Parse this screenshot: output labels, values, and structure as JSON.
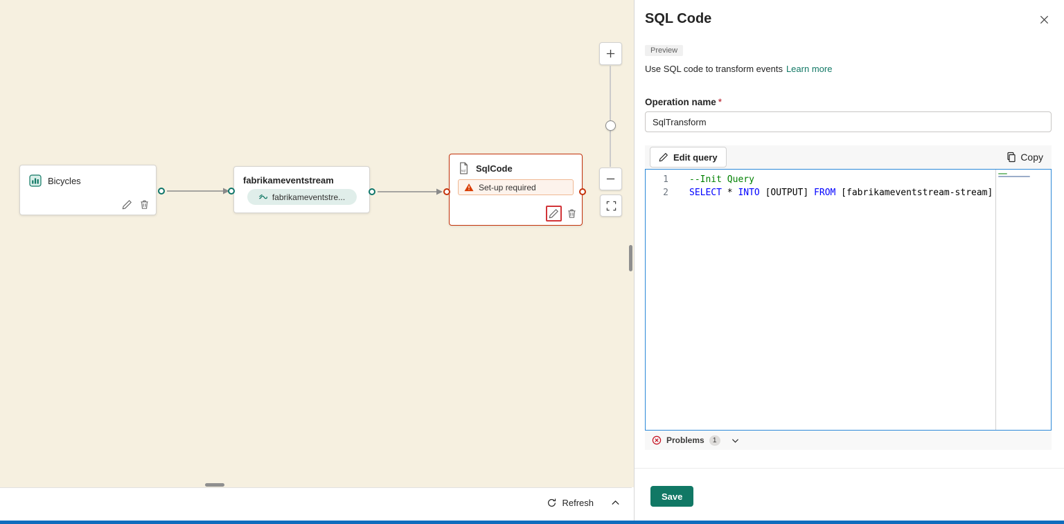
{
  "canvas": {
    "nodes": {
      "bicycles": {
        "title": "Bicycles"
      },
      "eventstream": {
        "title": "fabrikameventstream",
        "badge": "fabrikameventstre..."
      },
      "sqlcode": {
        "title": "SqlCode",
        "warning": "Set-up required"
      }
    },
    "footer": {
      "refresh": "Refresh"
    }
  },
  "panel": {
    "title": "SQL Code",
    "preview": "Preview",
    "description": "Use SQL code to transform events",
    "learn_more": "Learn more",
    "operation": {
      "label": "Operation name",
      "required": "*",
      "value": "SqlTransform"
    },
    "toolbar": {
      "edit_query": "Edit query",
      "copy": "Copy"
    },
    "editor": {
      "lines": [
        {
          "number": "1",
          "segments": [
            {
              "text": "--Init Query",
              "type": "comment"
            }
          ]
        },
        {
          "number": "2",
          "segments": [
            {
              "text": "SELECT",
              "type": "keyword"
            },
            {
              "text": " * ",
              "type": "plain"
            },
            {
              "text": "INTO",
              "type": "keyword"
            },
            {
              "text": " [OUTPUT] ",
              "type": "plain"
            },
            {
              "text": "FROM",
              "type": "keyword"
            },
            {
              "text": " [fabrikameventstream-stream]",
              "type": "plain"
            }
          ]
        }
      ]
    },
    "problems": {
      "label": "Problems",
      "count": "1"
    },
    "save": "Save"
  },
  "colors": {
    "canvas_background": "#f6f0e0",
    "accent_teal": "#117865",
    "error_orange": "#c4320a",
    "highlight_red": "#d13438",
    "editor_focus_border": "#2b88d8",
    "keyword_blue": "#0000ff",
    "comment_green": "#008000",
    "link_teal": "#117865",
    "bottom_strip_blue": "#0f6cbd"
  }
}
